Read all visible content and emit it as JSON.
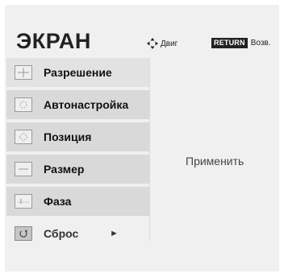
{
  "screen": {
    "title": "ЭКРАН",
    "hints": {
      "move_label": "Двиг",
      "return_key": "RETURN",
      "return_label": "Возв."
    }
  },
  "menu": {
    "items": [
      {
        "label": "Разрешение",
        "icon": "resolution-icon"
      },
      {
        "label": "Автонастройка",
        "icon": "auto-config-icon"
      },
      {
        "label": "Позиция",
        "icon": "position-icon"
      },
      {
        "label": "Размер",
        "icon": "size-icon"
      },
      {
        "label": "Фаза",
        "icon": "phase-icon"
      },
      {
        "label": "Сброс",
        "icon": "reset-icon"
      }
    ],
    "selected_index": 0
  },
  "content": {
    "apply_label": "Применить"
  },
  "colors": {
    "panel_bg": "#f0f0f0",
    "item_bg": "#d9d9d9",
    "return_key_bg": "#222222"
  }
}
